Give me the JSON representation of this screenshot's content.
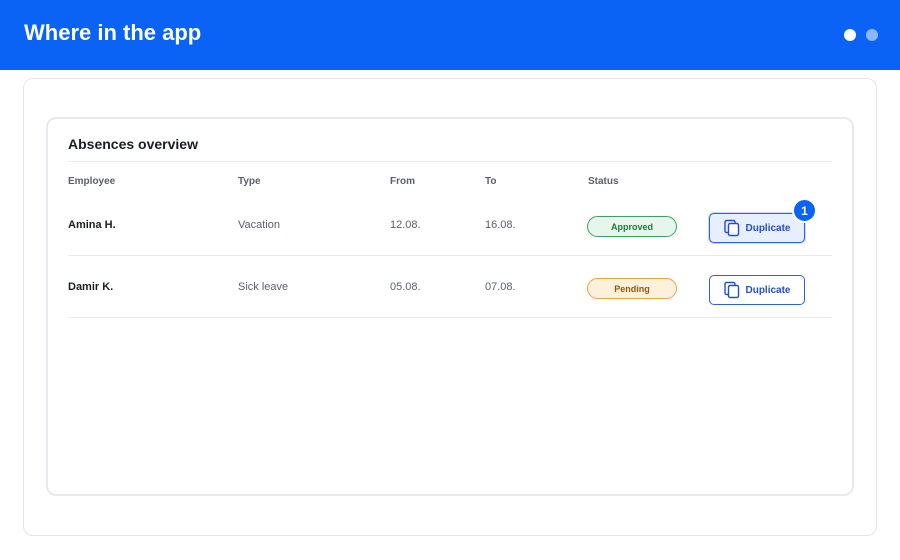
{
  "header": {
    "title": "Where in the app"
  },
  "card": {
    "title": "Absences overview"
  },
  "columns": {
    "employee": "Employee",
    "type": "Type",
    "from": "From",
    "to": "To",
    "status": "Status"
  },
  "rows": [
    {
      "employee": "Amina H.",
      "type": "Vacation",
      "from": "12.08.",
      "to": "16.08.",
      "status": "Approved",
      "action": "Duplicate"
    },
    {
      "employee": "Damir K.",
      "type": "Sick leave",
      "from": "05.08.",
      "to": "07.08.",
      "status": "Pending",
      "action": "Duplicate"
    }
  ],
  "step_marker": "1",
  "icons": {
    "action": "copy-icon"
  },
  "colors": {
    "brand": "#0b63f6",
    "approved": "#37a35a",
    "pending": "#e7a63c",
    "button": "#2f62d6"
  }
}
